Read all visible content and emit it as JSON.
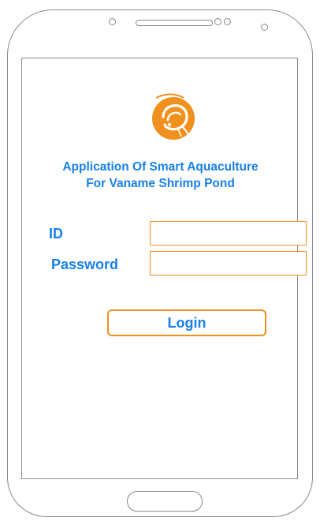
{
  "app": {
    "title_line1": "Application Of Smart Aquaculture",
    "title_line2": "For Vaname Shrimp Pond",
    "logo_icon": "shrimp-logo-icon"
  },
  "form": {
    "id_label": "ID",
    "id_value": "",
    "password_label": "Password",
    "password_value": "",
    "login_label": "Login"
  },
  "colors": {
    "accent_blue": "#1780ea",
    "accent_orange": "#f0911e",
    "frame_gray": "#8a8a8a"
  }
}
